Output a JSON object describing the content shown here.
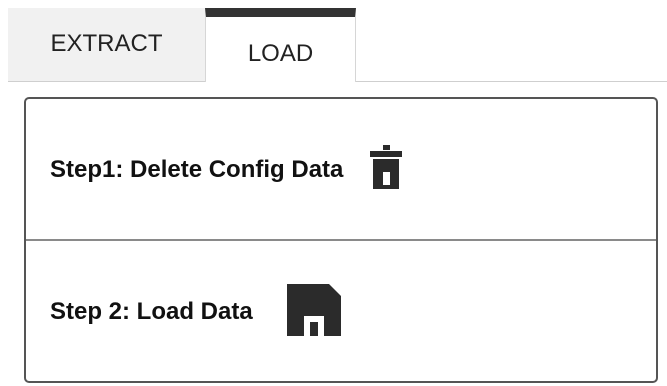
{
  "tabs": {
    "extract_label": "EXTRACT",
    "load_label": "LOAD",
    "active_tab": "LOAD"
  },
  "steps": [
    {
      "label": "Step1: Delete Config Data",
      "icon": "trash-icon"
    },
    {
      "label": "Step 2: Load Data",
      "icon": "save-icon"
    }
  ],
  "colors": {
    "active_tab_indicator": "#333333",
    "inactive_tab_bg": "#f1f1f1",
    "panel_border": "#555555",
    "icon": "#2b2b2b"
  }
}
